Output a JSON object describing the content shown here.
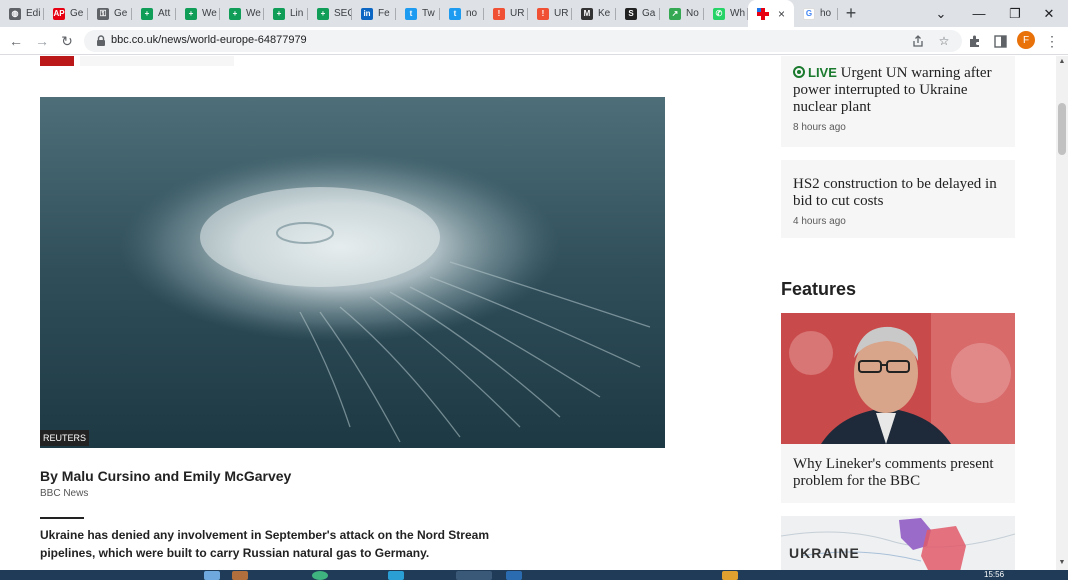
{
  "browser": {
    "tabs": [
      {
        "label": "Edi",
        "icon": "globe-icon",
        "color": "#5f6368"
      },
      {
        "label": "Ge",
        "icon": "ap-icon",
        "color": "#e60012"
      },
      {
        "label": "Ge",
        "icon": "lock-icon",
        "color": "#5f6368"
      },
      {
        "label": "Att",
        "icon": "plus-green-icon",
        "color": "#0f9d58"
      },
      {
        "label": "We",
        "icon": "plus-green-icon",
        "color": "#0f9d58"
      },
      {
        "label": "We",
        "icon": "plus-green-icon",
        "color": "#0f9d58"
      },
      {
        "label": "Lin",
        "icon": "plus-green-icon",
        "color": "#0f9d58"
      },
      {
        "label": "SEC",
        "icon": "plus-green-icon",
        "color": "#0f9d58"
      },
      {
        "label": "Fe",
        "icon": "linkedin-icon",
        "color": "#0a66c2"
      },
      {
        "label": "Tw",
        "icon": "twitter-icon",
        "color": "#1d9bf0"
      },
      {
        "label": "no",
        "icon": "twitter-icon",
        "color": "#1d9bf0"
      },
      {
        "label": "UR",
        "icon": "alert-icon",
        "color": "#f05033"
      },
      {
        "label": "UR",
        "icon": "alert-icon",
        "color": "#f05033"
      },
      {
        "label": "Ke",
        "icon": "gmail-icon",
        "color": "#333333"
      },
      {
        "label": "Ga",
        "icon": "s-icon",
        "color": "#222222"
      },
      {
        "label": "No",
        "icon": "trend-icon",
        "color": "#34a853"
      },
      {
        "label": "Wh",
        "icon": "whatsapp-icon",
        "color": "#25d366"
      }
    ],
    "active_tab": {
      "icon": "bbc-plus-icon",
      "color": "#e60012",
      "close": "×"
    },
    "google_tab": {
      "label": "ho",
      "icon": "google-icon",
      "color": "#4285f4"
    },
    "new_tab": "+",
    "window": {
      "chevron": "⌄",
      "minimize": "—",
      "restore": "❐",
      "close": "✕"
    },
    "nav": {
      "back": "←",
      "forward": "→",
      "reload": "↻"
    },
    "url": "bbc.co.uk/news/world-europe-64877979",
    "profile_initial": "F"
  },
  "article": {
    "image_credit": "REUTERS",
    "byline": "By Malu Cursino and Emily McGarvey",
    "source": "BBC News",
    "lead": "Ukraine has denied any involvement in September's attack on the Nord Stream pipelines, which were built to carry Russian natural gas to Germany."
  },
  "sidebar": {
    "stories": [
      {
        "live": "LIVE",
        "headline": "Urgent UN warning after power interrupted to Ukraine nuclear plant",
        "time": "8 hours ago"
      },
      {
        "headline": "HS2 construction to be delayed in bid to cut costs",
        "time": "4 hours ago"
      }
    ],
    "features_heading": "Features",
    "feature": {
      "headline": "Why Lineker's comments present problem for the BBC"
    },
    "map_label": "UKRAINE"
  },
  "taskbar": {
    "clock": "15:56"
  }
}
